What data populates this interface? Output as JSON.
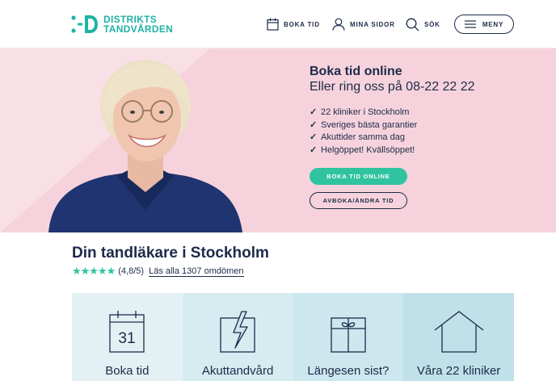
{
  "header": {
    "logo_line1": "DISTRIKTS",
    "logo_line2": "TANDVÅRDEN",
    "nav": {
      "boka_tid": "BOKA TID",
      "mina_sidor": "MINA SIDOR",
      "sok": "SÖK",
      "meny": "MENY"
    }
  },
  "hero": {
    "title": "Boka tid online",
    "subtitle": "Eller ring oss på 08-22 22 22",
    "checklist": [
      "22 kliniker i Stockholm",
      "Sveriges bästa garantier",
      "Akuttider samma dag",
      "Helgöppet! Kvällsöppet!"
    ],
    "check_glyph": "✓",
    "primary_button": "BOKA TID ONLINE",
    "secondary_button": "AVBOKA/ÄNDRA TID"
  },
  "section": {
    "title": "Din tandläkare i Stockholm",
    "stars": "★★★★★",
    "rating": 4.8,
    "score_text": "(4,8/5)",
    "reviews_link": "Läs alla 1307 omdömen"
  },
  "cards": [
    {
      "label": "Boka tid",
      "icon": "calendar-icon",
      "calendar_day": "31"
    },
    {
      "label": "Akuttandvård",
      "icon": "lightning-icon"
    },
    {
      "label": "Längesen sist?",
      "icon": "gift-icon"
    },
    {
      "label": "Våra 22 kliniker",
      "icon": "house-icon"
    }
  ],
  "colors": {
    "brand_teal": "#1fb3a5",
    "accent_green": "#2fc49f",
    "navy": "#1d2a4a",
    "hero_pink": "#f6d3dc"
  }
}
